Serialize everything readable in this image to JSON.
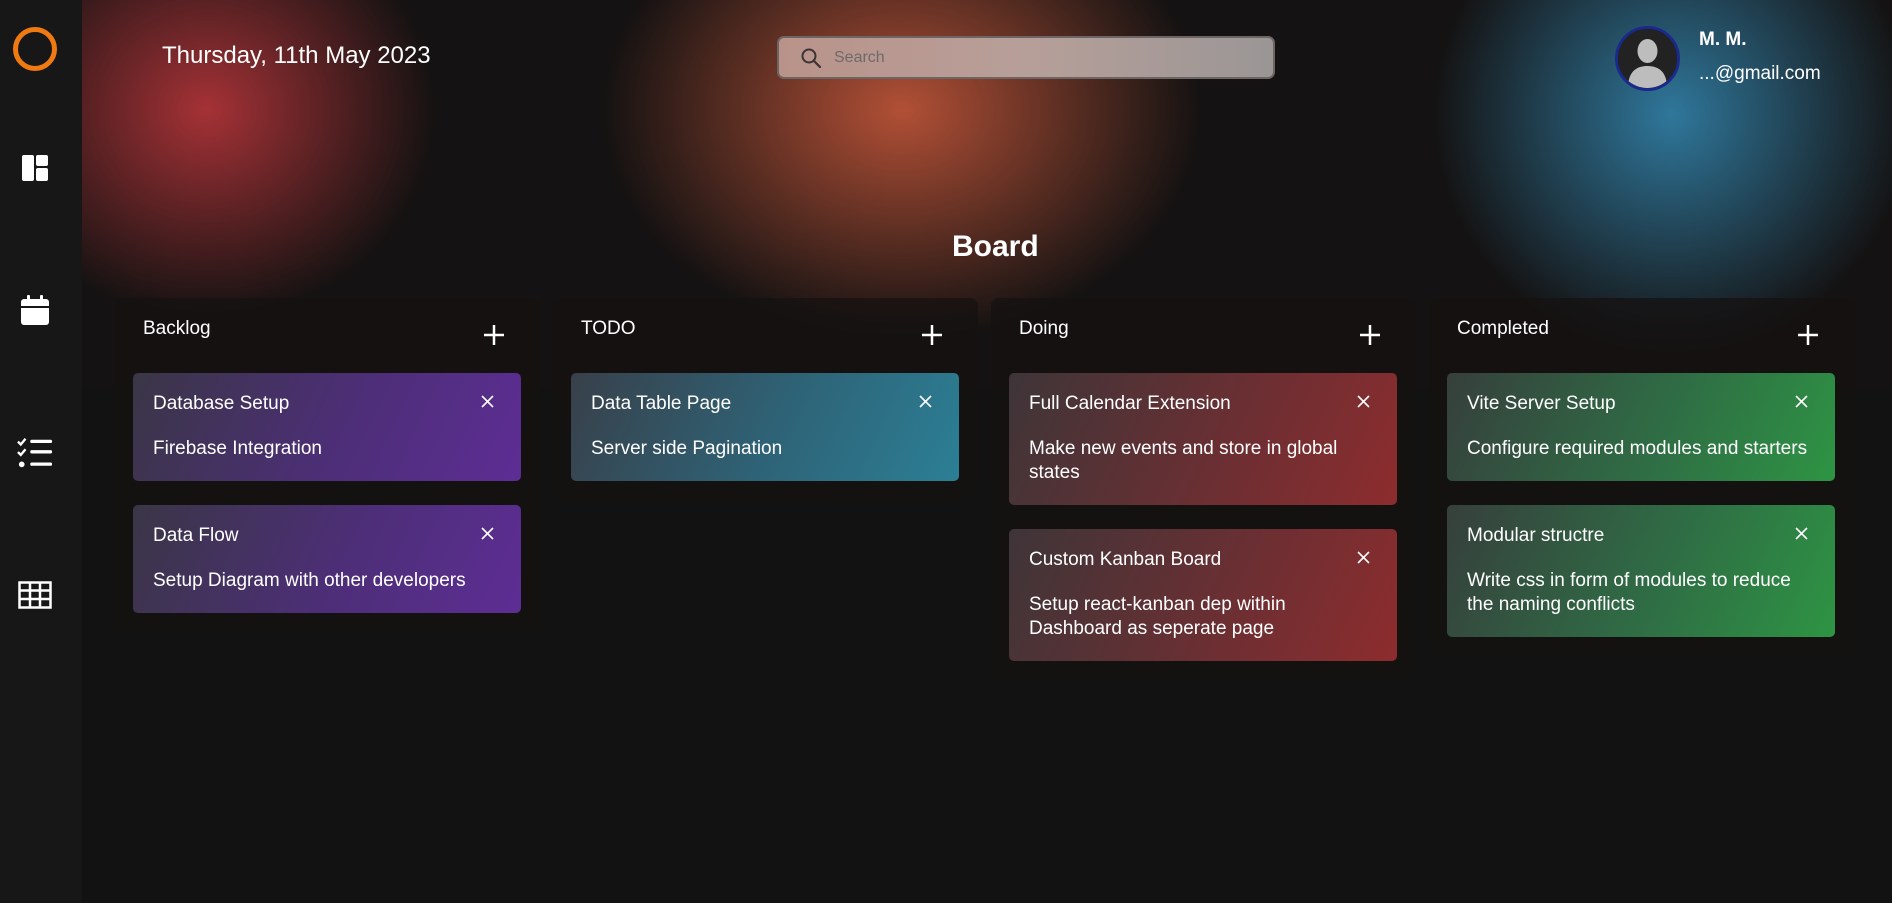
{
  "sidebar": {
    "logo": "ring-logo",
    "items": [
      {
        "icon": "dashboard-icon"
      },
      {
        "icon": "calendar-icon"
      },
      {
        "icon": "checklist-icon"
      },
      {
        "icon": "table-grid-icon"
      }
    ]
  },
  "header": {
    "date": "Thursday, 11th May 2023",
    "search": {
      "placeholder": "Search",
      "value": ""
    },
    "user": {
      "name": "M. M.",
      "email": "...@gmail.com"
    }
  },
  "board": {
    "title": "Board",
    "columns": [
      {
        "title": "Backlog",
        "cards": [
          {
            "title": "Database Setup",
            "description": "Firebase Integration",
            "color": "#5d2d94"
          },
          {
            "title": "Data Flow",
            "description": "Setup Diagram with other developers",
            "color": "#5d2d94"
          }
        ]
      },
      {
        "title": "TODO",
        "cards": [
          {
            "title": "Data Table Page",
            "description": "Server side Pagination",
            "color": "#2c7f95"
          }
        ]
      },
      {
        "title": "Doing",
        "cards": [
          {
            "title": "Full Calendar Extension",
            "description": "Make new events and store in global states",
            "color": "#8d2c2e"
          },
          {
            "title": "Custom Kanban Board",
            "description": "Setup react-kanban dep within Dashboard as seperate page",
            "color": "#8d2c2e"
          }
        ]
      },
      {
        "title": "Completed",
        "cards": [
          {
            "title": "Vite Server Setup",
            "description": "Configure required modules and starters",
            "color": "#2e9443"
          },
          {
            "title": "Modular structre",
            "description": "Write css in form of modules to reduce the naming conflicts",
            "color": "#2e9443"
          }
        ]
      }
    ]
  },
  "colors": {
    "accent": "#f07a12",
    "background": "#121212",
    "sidebar": "#171717"
  }
}
